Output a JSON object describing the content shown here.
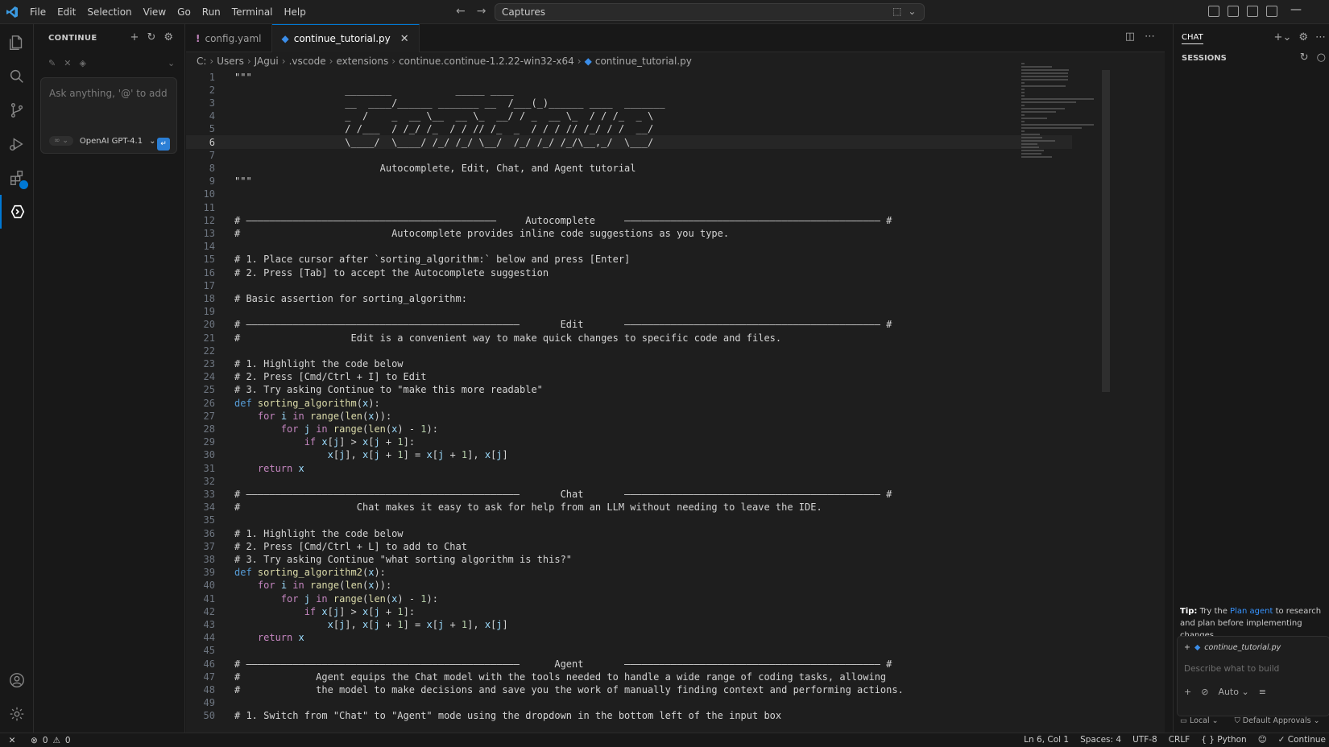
{
  "titlebar": {
    "menu": [
      "File",
      "Edit",
      "Selection",
      "View",
      "Go",
      "Run",
      "Terminal",
      "Help"
    ],
    "command_center": "Captures"
  },
  "activitybar": {
    "items": [
      "explorer-icon",
      "search-icon",
      "source-control-icon",
      "run-debug-icon",
      "extensions-icon",
      "continue-icon"
    ],
    "bottom": [
      "account-icon",
      "manage-gear-icon"
    ]
  },
  "sidebar": {
    "title": "CONTINUE",
    "input_placeholder": "Ask anything, '@' to add context",
    "model": "OpenAI GPT-4.1"
  },
  "tabs": [
    {
      "label": "config.yaml",
      "active": false
    },
    {
      "label": "continue_tutorial.py",
      "active": true
    }
  ],
  "breadcrumb": [
    "C:",
    "Users",
    "JAgui",
    ".vscode",
    "extensions",
    "continue.continue-1.2.22-win32-x64",
    "continue_tutorial.py"
  ],
  "code_lines": [
    "\"\"\"",
    "                   ________           _____ ____",
    "                   __  ____/______ _______ __  /___(_)______ ____  _______",
    "                   _  /    _  __ \\__  __ \\_  __/ / _  __ \\_  / / /_  _ \\",
    "                   / /___  / /_/ /_  / / // /_  _  / / / // /_/ / /  __/",
    "                   \\____/  \\____/ /_/ /_/ \\__/  /_/ /_/ /_/\\__,_/  \\___/",
    "",
    "                         Autocomplete, Edit, Chat, and Agent tutorial",
    "\"\"\"",
    "",
    "",
    "# ———————————————————————————————————————————     Autocomplete     ———————————————————————————————————————————— #",
    "#                          Autocomplete provides inline code suggestions as you type.",
    "",
    "# 1. Place cursor after `sorting_algorithm:` below and press [Enter]",
    "# 2. Press [Tab] to accept the Autocomplete suggestion",
    "",
    "# Basic assertion for sorting_algorithm:",
    "",
    "# ———————————————————————————————————————————————       Edit       ———————————————————————————————————————————— #",
    "#                   Edit is a convenient way to make quick changes to specific code and files.",
    "",
    "# 1. Highlight the code below",
    "# 2. Press [Cmd/Ctrl + I] to Edit",
    "# 3. Try asking Continue to \"make this more readable\"",
    "def sorting_algorithm(x):",
    "    for i in range(len(x)):",
    "        for j in range(len(x) - 1):",
    "            if x[j] > x[j + 1]:",
    "                x[j], x[j + 1] = x[j + 1], x[j]",
    "    return x",
    "",
    "# ———————————————————————————————————————————————       Chat       ———————————————————————————————————————————— #",
    "#                    Chat makes it easy to ask for help from an LLM without needing to leave the IDE.",
    "",
    "# 1. Highlight the code below",
    "# 2. Press [Cmd/Ctrl + L] to add to Chat",
    "# 3. Try asking Continue \"what sorting algorithm is this?\"",
    "def sorting_algorithm2(x):",
    "    for i in range(len(x)):",
    "        for j in range(len(x) - 1):",
    "            if x[j] > x[j + 1]:",
    "                x[j], x[j + 1] = x[j + 1], x[j]",
    "    return x",
    "",
    "# ———————————————————————————————————————————————      Agent       ———————————————————————————————————————————— #",
    "#             Agent equips the Chat model with the tools needed to handle a wide range of coding tasks, allowing",
    "#             the model to make decisions and save you the work of manually finding context and performing actions.",
    "",
    "# 1. Switch from \"Chat\" to \"Agent\" mode using the dropdown in the bottom left of the input box"
  ],
  "current_line": 6,
  "chatpanel": {
    "title": "CHAT",
    "sessions_label": "SESSIONS",
    "tip_bold": "Tip:",
    "tip_pre": "Try the",
    "tip_link": "Plan agent",
    "tip_post": "to research and plan before implementing changes.",
    "context_file": "continue_tutorial.py",
    "input_placeholder": "Describe what to build",
    "mode": "Auto",
    "bottom_left": "Local",
    "bottom_right": "Default Approvals"
  },
  "statusbar": {
    "errors": "0",
    "warnings": "0",
    "position": "Ln 6, Col 1",
    "spaces": "Spaces: 4",
    "encoding": "UTF-8",
    "eol": "CRLF",
    "language": "Python",
    "extension": "Continue"
  },
  "colors": {
    "accent": "#0078d4",
    "background": "#1e1e1e",
    "keyword": "#c586c0",
    "function": "#dcdcaa",
    "variable": "#9cdcfe",
    "number": "#b5cea8"
  }
}
